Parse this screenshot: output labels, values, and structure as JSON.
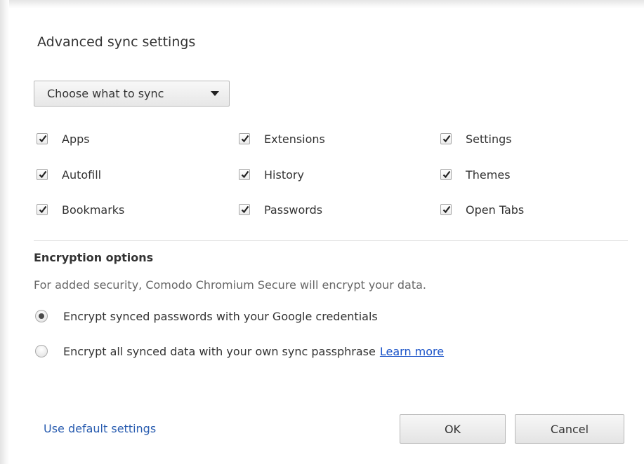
{
  "dialog": {
    "title": "Advanced sync settings"
  },
  "sync_select": {
    "selected": "Choose what to sync"
  },
  "checkboxes": [
    {
      "label": "Apps",
      "checked": true
    },
    {
      "label": "Extensions",
      "checked": true
    },
    {
      "label": "Settings",
      "checked": true
    },
    {
      "label": "Autofill",
      "checked": true
    },
    {
      "label": "History",
      "checked": true
    },
    {
      "label": "Themes",
      "checked": true
    },
    {
      "label": "Bookmarks",
      "checked": true
    },
    {
      "label": "Passwords",
      "checked": true
    },
    {
      "label": "Open Tabs",
      "checked": true
    }
  ],
  "encryption": {
    "heading": "Encryption options",
    "description": "For added security, Comodo Chromium Secure will encrypt your data.",
    "options": [
      {
        "label": "Encrypt synced passwords with your Google credentials",
        "selected": true
      },
      {
        "label": "Encrypt all synced data with your own sync passphrase",
        "selected": false
      }
    ],
    "learn_more": "Learn more"
  },
  "footer": {
    "default_link": "Use default settings",
    "ok_label": "OK",
    "cancel_label": "Cancel"
  }
}
